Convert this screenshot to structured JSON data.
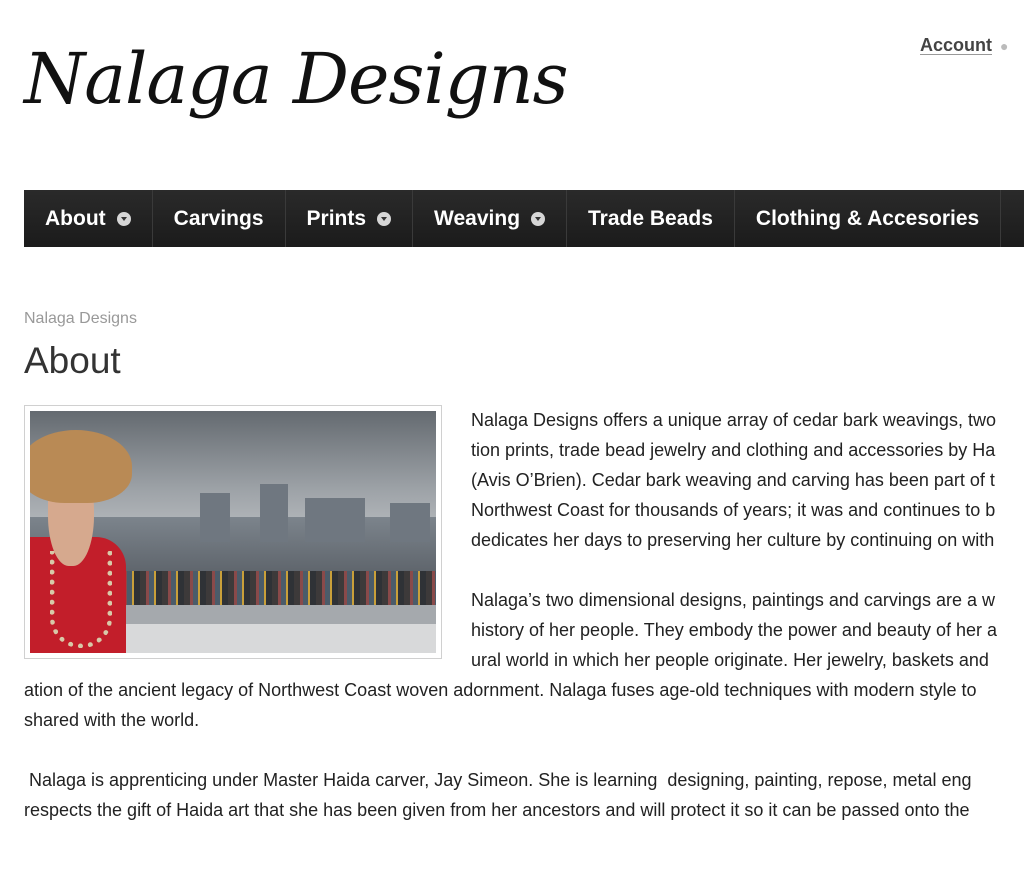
{
  "site": {
    "logo_text": "Nalaga Designs"
  },
  "utility": {
    "account_label": "Account"
  },
  "nav": {
    "items": [
      {
        "label": "About"
      },
      {
        "label": "Carvings"
      },
      {
        "label": "Prints"
      },
      {
        "label": "Weaving"
      },
      {
        "label": "Trade Beads"
      },
      {
        "label": "Clothing & Accesories"
      }
    ]
  },
  "breadcrumb": "Nalaga Designs",
  "page_title": "About",
  "content": {
    "p1_lines": [
      "Nalaga Designs offers a unique array of cedar bark weavings, two",
      "tion prints, trade bead jewelry and clothing and accessories by  Ha",
      "(Avis O’Brien). Cedar bark weaving and carving has been part of t",
      "Northwest Coast for thousands of years; it was and continues to b",
      "dedicates her days to preserving her culture by continuing on with"
    ],
    "p2_lines": [
      "Nalaga’s two dimensional designs, paintings and carvings are a w",
      "history of her people. They embody the power and beauty of her a",
      "ural world in which her people originate. Her jewelry, baskets and",
      "ation of the ancient legacy of Northwest Coast woven adornment. Nalaga fuses age-old techniques with modern style to",
      "shared with the world."
    ],
    "p3_lines": [
      " Nalaga is apprenticing under Master Haida carver, Jay Simeon. She is learning  designing, painting, repose, metal eng",
      "respects the gift of Haida art that she has been given from her ancestors and will protect it so it can be passed onto the"
    ]
  }
}
